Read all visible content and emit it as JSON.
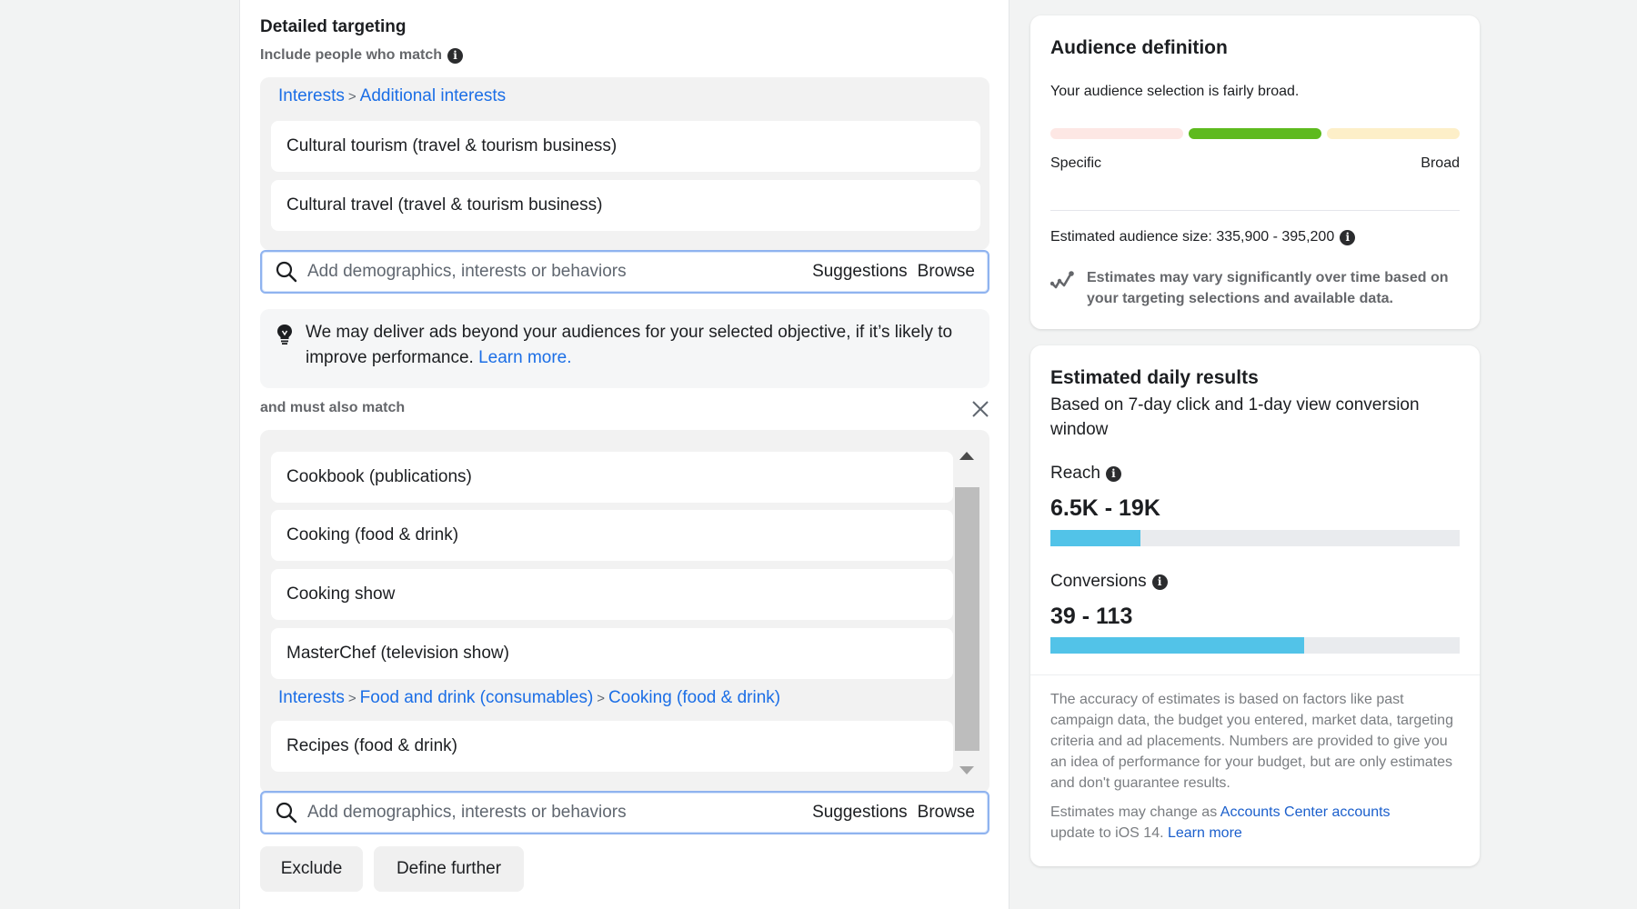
{
  "detailed_targeting": {
    "title": "Detailed targeting",
    "include_label": "Include people who match",
    "include_group": {
      "breadcrumb": [
        "Interests",
        "Additional interests"
      ],
      "items": [
        "Cultural tourism (travel & tourism business)",
        "Cultural travel (travel & tourism business)"
      ]
    },
    "search": {
      "placeholder": "Add demographics, interests or behaviors",
      "suggestions_label": "Suggestions",
      "browse_label": "Browse"
    },
    "notice": {
      "text": "We may deliver ads beyond your audiences for your selected objective, if it’s likely to improve performance.",
      "link": "Learn more."
    },
    "must_match_label": "and must also match",
    "must_group": {
      "items": [
        "Cookbook (publications)",
        "Cooking (food & drink)",
        "Cooking show",
        "MasterChef (television show)"
      ],
      "breadcrumb": [
        "Interests",
        "Food and drink (consumables)",
        "Cooking (food & drink)"
      ],
      "items_after": [
        "Recipes (food & drink)"
      ]
    },
    "buttons": {
      "exclude": "Exclude",
      "define_further": "Define further"
    },
    "breadcrumb_separator": ">"
  },
  "audience_definition": {
    "title": "Audience definition",
    "summary": "Your audience selection is fairly broad.",
    "meter": {
      "active_segment": 2,
      "segments": 3,
      "colors": [
        "#fde7e4",
        "#5eba1e",
        "#fdefc8"
      ]
    },
    "specific_label": "Specific",
    "broad_label": "Broad",
    "size_text": "Estimated audience size: 335,900 - 395,200",
    "warning": "Estimates may vary significantly over time based on your targeting selections and available data."
  },
  "daily_results": {
    "title": "Estimated daily results",
    "subtitle": "Based on 7-day click and 1-day view conversion window",
    "reach": {
      "label": "Reach",
      "value": "6.5K - 19K",
      "bar_fraction": 0.22
    },
    "conversions": {
      "label": "Conversions",
      "value": "39 - 113",
      "bar_fraction": 0.62
    },
    "bar_color": "#52c3e8",
    "disclaimer": "The accuracy of estimates is based on factors like past campaign data, the budget you entered, market data, targeting criteria and ad placements. Numbers are provided to give you an idea of performance for your budget, but are only estimates and don't guarantee results.",
    "ios_note_prefix": "Estimates may change as",
    "ios_note_link": "Accounts Center accounts",
    "ios_note_suffix": "update to iOS 14.",
    "learn_more": "Learn more"
  },
  "colors": {
    "link": "#1b6ee6",
    "accent_green": "#5eba1e"
  }
}
